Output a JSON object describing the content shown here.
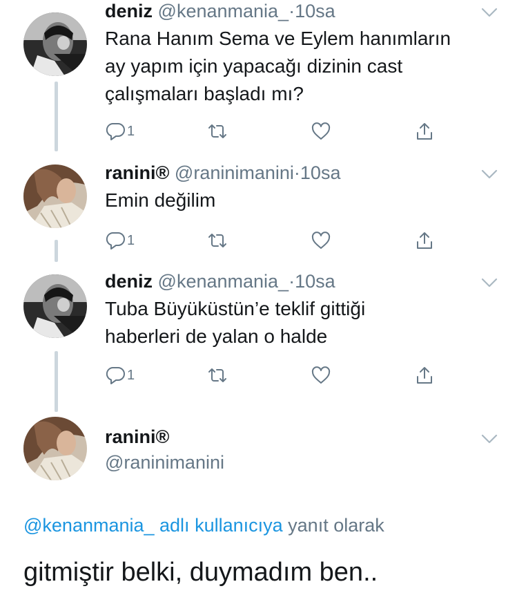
{
  "tweets": [
    {
      "name": "deniz",
      "handle": "@kenanmania_",
      "sep": "·",
      "time": "10sa",
      "lines": [
        "Rana Hanım Sema ve Eylem hanımların",
        "ay yapım için yapacağı dizinin cast",
        "çalışmaları başladı mı?"
      ],
      "reply_count": "1"
    },
    {
      "name": "ranini®",
      "handle": "@raninimanini",
      "sep": "·",
      "time": "10sa",
      "lines": [
        "Emin değilim"
      ],
      "reply_count": "1"
    },
    {
      "name": "deniz",
      "handle": "@kenanmania_",
      "sep": "·",
      "time": "10sa",
      "lines": [
        "Tuba Büyüküstün’e teklif gittiği",
        "haberleri de yalan o halde"
      ],
      "reply_count": "1"
    }
  ],
  "focus": {
    "name": "ranini®",
    "handle": "@raninimanini",
    "reply_to_link": "@kenanmania_ adlı kullanıcıya",
    "reply_to_rest": "yanıt olarak",
    "text": "gitmiştir belki, duymadım ben.."
  },
  "icons": [
    "reply-icon",
    "retweet-icon",
    "like-icon",
    "share-icon",
    "chevron-down-icon"
  ],
  "colors": {
    "link": "#1b95e0",
    "secondary": "#657786",
    "thread_line": "#ccd6dd"
  }
}
